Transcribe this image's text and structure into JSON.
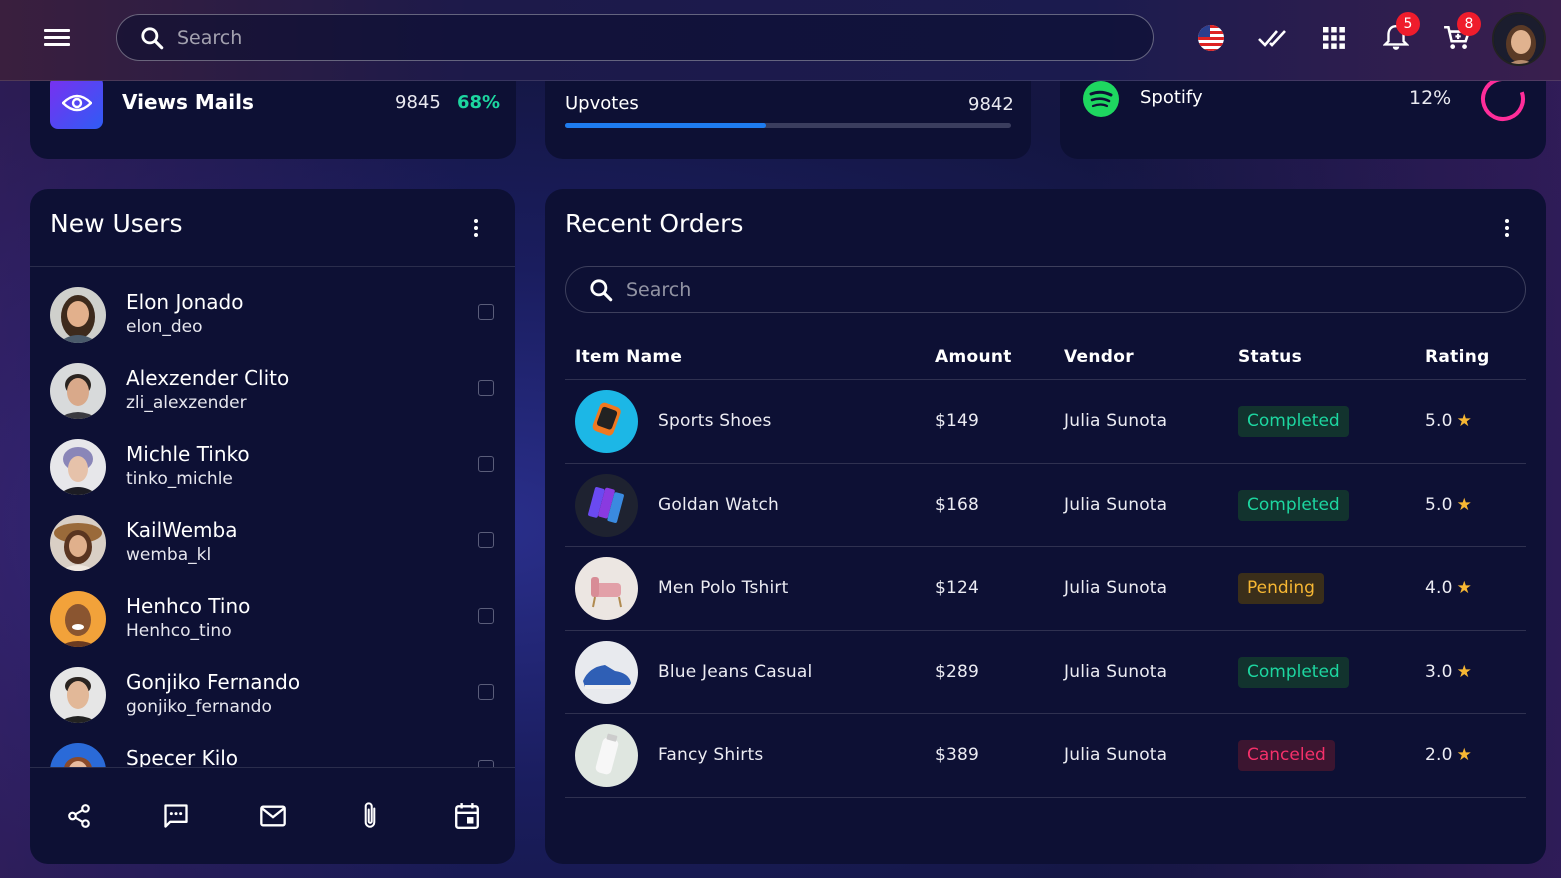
{
  "topbar": {
    "search_placeholder": "Search",
    "notifications_count": "5",
    "cart_count": "8"
  },
  "stats": {
    "views": {
      "label": "Views Mails",
      "value": "9845",
      "percent": "68%"
    },
    "upvotes": {
      "label": "Upvotes",
      "value": "9842",
      "progress_percent": 45
    },
    "spotify": {
      "label": "Spotify",
      "percent": "12%"
    }
  },
  "new_users": {
    "title": "New Users",
    "users": [
      {
        "name": "Elon Jonado",
        "handle": "elon_deo"
      },
      {
        "name": "Alexzender Clito",
        "handle": "zli_alexzender"
      },
      {
        "name": "Michle Tinko",
        "handle": "tinko_michle"
      },
      {
        "name": "KailWemba",
        "handle": "wemba_kl"
      },
      {
        "name": "Henhco Tino",
        "handle": "Henhco_tino"
      },
      {
        "name": "Gonjiko Fernando",
        "handle": "gonjiko_fernando"
      },
      {
        "name": "Specer Kilo",
        "handle": ""
      }
    ]
  },
  "recent_orders": {
    "title": "Recent Orders",
    "search_placeholder": "Search",
    "columns": [
      "Item Name",
      "Amount",
      "Vendor",
      "Status",
      "Rating"
    ],
    "rows": [
      {
        "item": "Sports Shoes",
        "amount": "$149",
        "vendor": "Julia Sunota",
        "status": "Completed",
        "rating": "5.0"
      },
      {
        "item": "Goldan Watch",
        "amount": "$168",
        "vendor": "Julia Sunota",
        "status": "Completed",
        "rating": "5.0"
      },
      {
        "item": "Men Polo Tshirt",
        "amount": "$124",
        "vendor": "Julia Sunota",
        "status": "Pending",
        "rating": "4.0"
      },
      {
        "item": "Blue Jeans Casual",
        "amount": "$289",
        "vendor": "Julia Sunota",
        "status": "Completed",
        "rating": "3.0"
      },
      {
        "item": "Fancy Shirts",
        "amount": "$389",
        "vendor": "Julia Sunota",
        "status": "Canceled",
        "rating": "2.0"
      }
    ]
  },
  "colors": {
    "accent_green": "#1dd6a0",
    "accent_blue": "#1e7cf0",
    "spotify_green": "#1ed760",
    "ring_pink": "#ff2d9a",
    "badge_red": "#ef1c2c"
  },
  "icons": {
    "topbar": [
      "menu-icon",
      "search-icon",
      "us-flag-icon",
      "double-check-icon",
      "apps-grid-icon",
      "bell-icon",
      "cart-icon"
    ],
    "users_footer": [
      "share-icon",
      "chat-icon",
      "mail-icon",
      "attachment-icon",
      "calendar-icon"
    ]
  }
}
